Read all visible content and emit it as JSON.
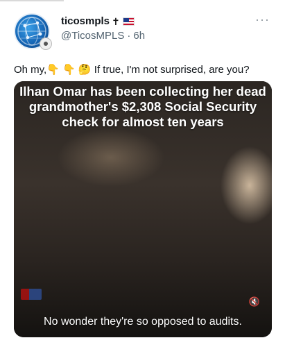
{
  "post": {
    "display_name": "ticosmpls",
    "cross": "✝",
    "handle": "@TicosMPLS",
    "separator": "·",
    "time": "6h",
    "more_label": "···",
    "text_before": "Oh my,",
    "emojis": "👇 👇 🤔",
    "text_after": " If true, I'm not surprised, are you?"
  },
  "media": {
    "caption_top": "Ilhan Omar has been collecting her dead grandmother's $2,308 Social Security check for almost ten years",
    "caption_bottom": "No wonder they're so opposed to audits.",
    "mute_icon": "🔇"
  },
  "icons": {
    "avatar": "globe-network-icon",
    "badge": "seal-icon",
    "flag": "us-flag-icon",
    "more": "more-options-icon",
    "mute": "speaker-muted-icon"
  },
  "colors": {
    "primary_text": "#0f1419",
    "secondary_text": "#536471"
  }
}
